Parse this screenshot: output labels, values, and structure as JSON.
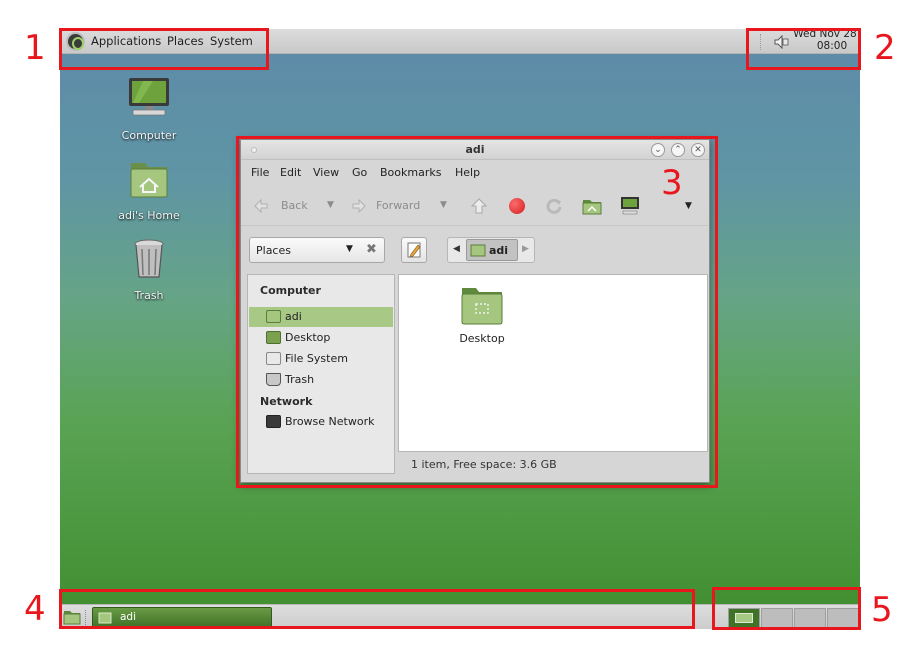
{
  "top_panel": {
    "menus": [
      "Applications",
      "Places",
      "System"
    ],
    "clock": {
      "line1": "Wed Nov 28",
      "line2": "08:00"
    }
  },
  "desktop_icons": [
    {
      "label": "Computer",
      "icon": "computer-icon"
    },
    {
      "label": "adi's Home",
      "icon": "home-folder-icon"
    },
    {
      "label": "Trash",
      "icon": "trash-icon"
    }
  ],
  "window": {
    "title": "adi",
    "menu": [
      "File",
      "Edit",
      "View",
      "Go",
      "Bookmarks",
      "Help"
    ],
    "toolbar": {
      "back": "Back",
      "forward": "Forward"
    },
    "places_combo": "Places",
    "path_button": "adi",
    "sidebar": {
      "computer_header": "Computer",
      "computer_items": [
        "adi",
        "Desktop",
        "File System",
        "Trash"
      ],
      "network_header": "Network",
      "network_items": [
        "Browse Network"
      ]
    },
    "content_items": [
      {
        "label": "Desktop",
        "icon": "folder-icon"
      }
    ],
    "status": "1 item, Free space: 3.6 GB"
  },
  "bottom_panel": {
    "task_label": "adi",
    "workspaces": 4,
    "active_workspace": 1
  },
  "annotations": [
    "1",
    "2",
    "3",
    "4",
    "5"
  ],
  "colors": {
    "annotation": "#e8171d",
    "accent": "#a8c985",
    "panel_green": "#3f7327"
  }
}
